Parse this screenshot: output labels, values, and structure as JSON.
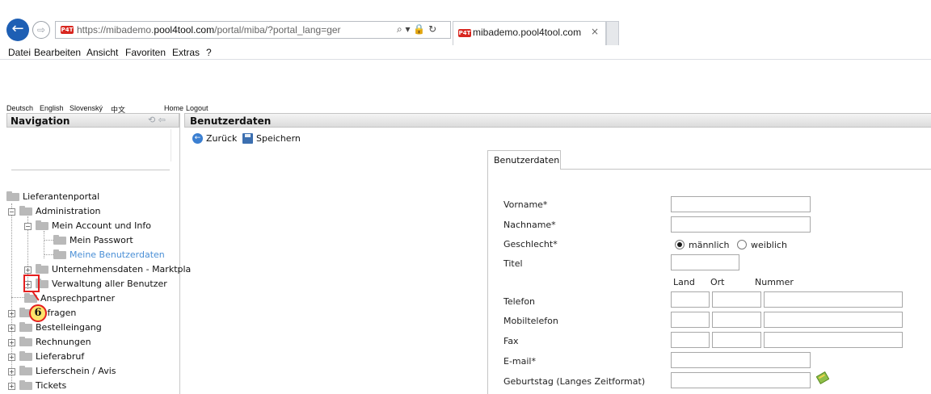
{
  "browser": {
    "url_prefix": "https://mibademo.",
    "url_domain": "pool4tool.com",
    "url_suffix": "/portal/miba/?portal_lang=ger",
    "address_icons": "⌕ ▾ 🔒 ↻",
    "tab_label": "mibademo.pool4tool.com",
    "tab_close": "×",
    "favicon_text": "P4T"
  },
  "menubar": [
    "Datei",
    "Bearbeiten",
    "Ansicht",
    "Favoriten",
    "Extras",
    "?"
  ],
  "top_links": {
    "languages": [
      "Deutsch",
      "English",
      "Slovenský",
      "中文"
    ],
    "home": "Home",
    "logout": "Logout"
  },
  "navigation": {
    "title": "Navigation",
    "tree": [
      {
        "label": "Lieferantenportal"
      },
      {
        "label": "Administration"
      },
      {
        "label": "Mein Account und Info"
      },
      {
        "label": "Mein Passwort"
      },
      {
        "label": "Meine Benutzerdaten"
      },
      {
        "label": "Unternehmensdaten - Marktpla"
      },
      {
        "label": "Verwaltung aller Benutzer"
      },
      {
        "label": "Ansprechpartner"
      },
      {
        "label": "Anfragen"
      },
      {
        "label": "Bestelleingang"
      },
      {
        "label": "Rechnungen"
      },
      {
        "label": "Lieferabruf"
      },
      {
        "label": "Lieferschein / Avis"
      },
      {
        "label": "Tickets"
      }
    ]
  },
  "annotation": {
    "step": "6"
  },
  "main": {
    "title": "Benutzerdaten",
    "back_label": "Zurück",
    "save_label": "Speichern",
    "tab_label": "Benutzerdaten",
    "fields": {
      "vorname": "Vorname*",
      "nachname": "Nachname*",
      "geschlecht": "Geschlecht*",
      "titel": "Titel",
      "telefon": "Telefon",
      "mobiltelefon": "Mobiltelefon",
      "fax": "Fax",
      "email": "E-mail*",
      "geburtstag": "Geburtstag (Langes Zeitformat)"
    },
    "gender_options": [
      "männlich",
      "weiblich"
    ],
    "gender_selected": "männlich",
    "phone_columns": [
      "Land",
      "Ort",
      "Nummer"
    ]
  }
}
